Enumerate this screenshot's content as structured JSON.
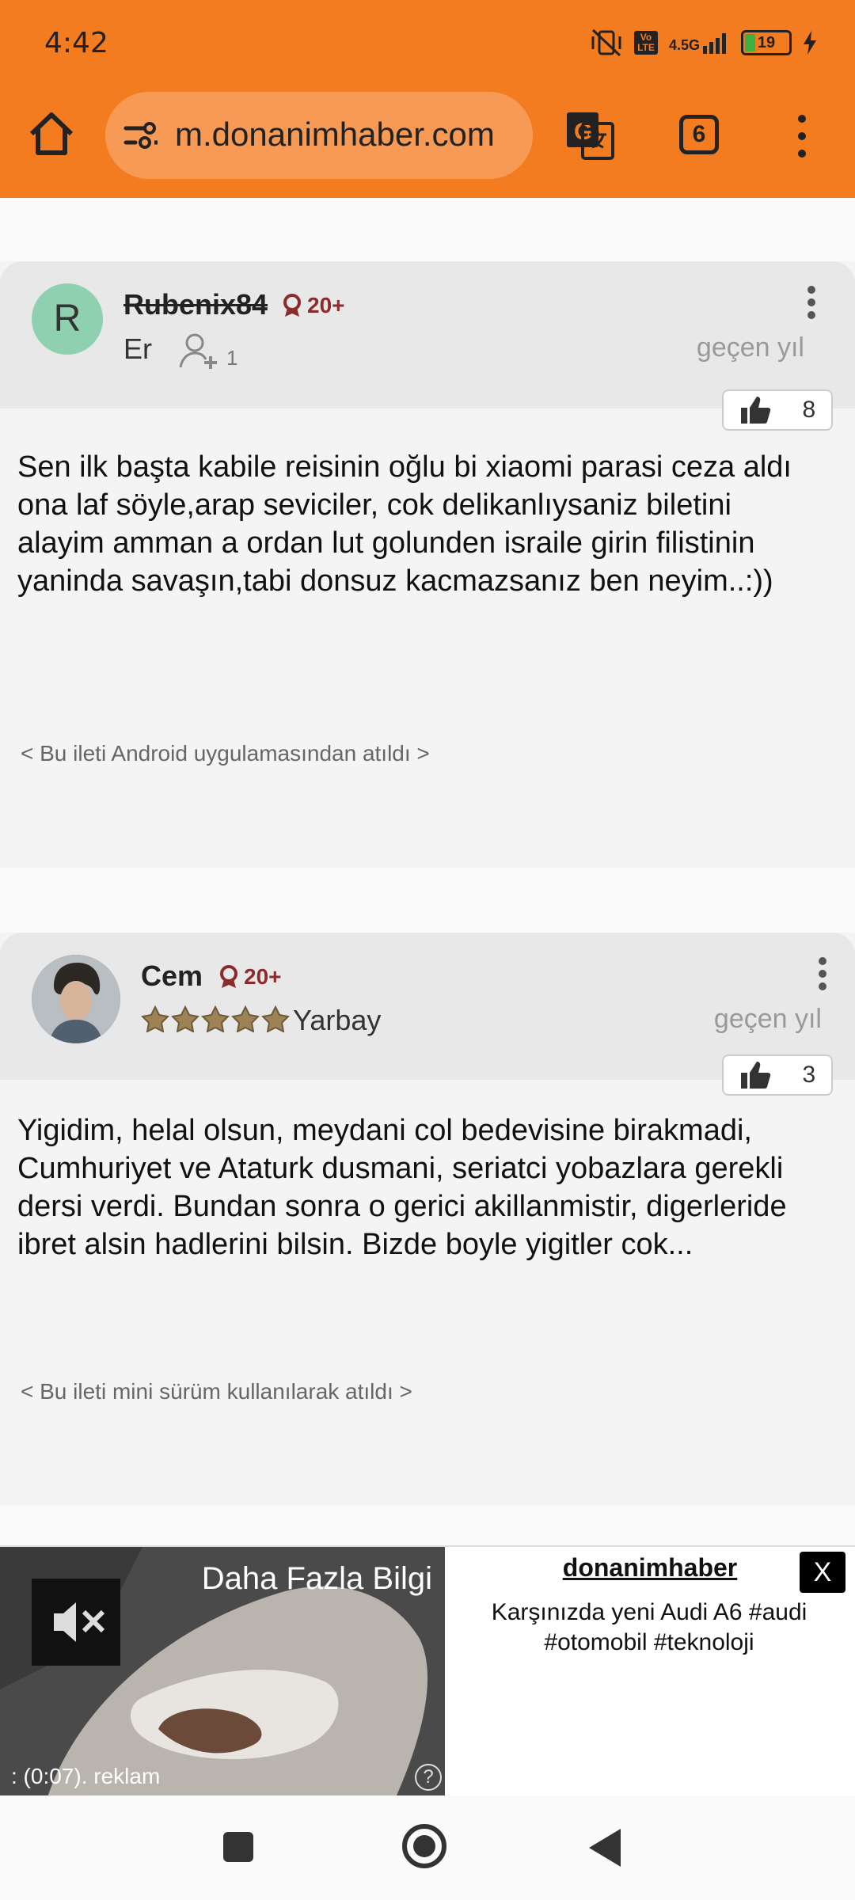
{
  "status_bar": {
    "time": "4:42",
    "network": "4.5G",
    "volte": "Vo LTE",
    "battery": "19"
  },
  "browser": {
    "url": "m.donanimhaber.com",
    "tab_count": "6"
  },
  "posts": [
    {
      "avatar_letter": "R",
      "username": "Rubenix84",
      "badge": "20+",
      "rank": "Er",
      "follow_count": "1",
      "time": "geçen yıl",
      "likes": "8",
      "text": "Sen ilk başta kabile reisinin oğlu bi xiaomi parasi ceza aldı ona laf söyle,arap seviciler, cok delikanlıysaniz biletini alayim amman a ordan lut golunden israile girin filistinin yaninda savaşın,tabi donsuz kacmazsanız ben neyim..:))",
      "signature": "< Bu ileti Android uygulamasından atıldı >"
    },
    {
      "username": "Cem",
      "badge": "20+",
      "rank": "Yarbay",
      "stars": 5,
      "time": "geçen yıl",
      "likes": "3",
      "text": "Yigidim, helal olsun, meydani col bedevisine birakmadi, Cumhuriyet ve Ataturk dusmani, seriatci yobazlara gerekli dersi verdi. Bundan sonra o gerici akillanmistir, digerleride ibret alsin hadlerini bilsin. Bizde boyle yigitler cok...",
      "signature": "< Bu ileti mini sürüm kullanılarak atıldı >"
    }
  ],
  "ad": {
    "video_title": "Daha Fazla Bilgi",
    "timer": ": (0:07). reklam",
    "help": "?",
    "brand": "donanimhaber",
    "close": "X",
    "description": "Karşınızda yeni Audi A6 #audi #otomobil #teknoloji"
  }
}
